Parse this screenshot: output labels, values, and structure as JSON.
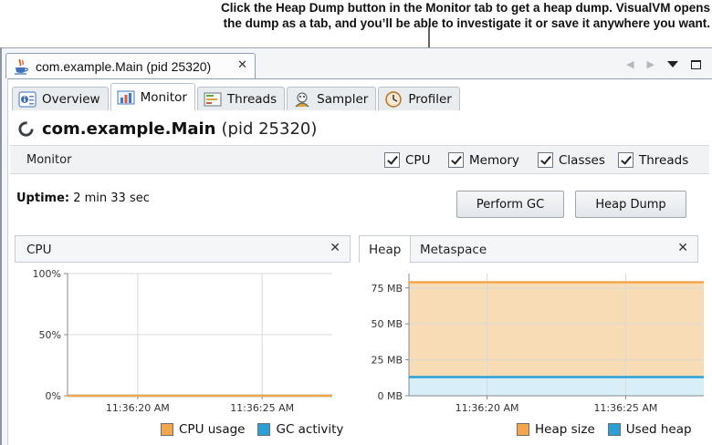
{
  "callout": {
    "line1": "Click the Heap Dump button in the Monitor tab to get a heap dump. VisualVM opens",
    "line2": "the dump as a tab, and you’ll be able to investigate it or save it anywhere you want."
  },
  "document_tab": {
    "label": "com.example.Main (pid 25320)",
    "close": "✕"
  },
  "subtabs": [
    {
      "label": "Overview",
      "icon": "overview-icon"
    },
    {
      "label": "Monitor",
      "icon": "monitor-chart-icon",
      "active": true
    },
    {
      "label": "Threads",
      "icon": "threads-icon"
    },
    {
      "label": "Sampler",
      "icon": "sampler-icon"
    },
    {
      "label": "Profiler",
      "icon": "profiler-icon"
    }
  ],
  "app": {
    "name": "com.example.Main",
    "pid": "(pid 25320)"
  },
  "monitor_bar": {
    "label": "Monitor",
    "checkboxes": [
      "CPU",
      "Memory",
      "Classes",
      "Threads"
    ]
  },
  "uptime": {
    "label": "Uptime:",
    "value": " 2 min 33 sec"
  },
  "buttons": {
    "perform_gc": "Perform GC",
    "heap_dump": "Heap Dump"
  },
  "cpu_panel": {
    "title": "CPU",
    "close": "✕",
    "legend": [
      "CPU usage",
      "GC activity"
    ]
  },
  "heap_panel": {
    "tabs": [
      "Heap",
      "Metaspace"
    ],
    "close": "✕",
    "legend": [
      "Heap size",
      "Used heap"
    ]
  },
  "colors": {
    "orange": "#f3a64b",
    "blue": "#2aa0d6",
    "heap_fill": "#f8dcb6",
    "used_fill": "#d8eef9"
  },
  "chart_data": [
    {
      "type": "line",
      "title": "CPU",
      "yticks": [
        "100%",
        "50%",
        "0%"
      ],
      "xticks": [
        "11:36:20 AM",
        "11:36:25 AM"
      ],
      "ylim": [
        0,
        100
      ],
      "series": [
        {
          "name": "CPU usage",
          "color": "#f3a64b",
          "values": [
            0,
            0
          ]
        },
        {
          "name": "GC activity",
          "color": "#2aa0d6",
          "values": [
            0,
            0
          ]
        }
      ]
    },
    {
      "type": "area",
      "title": "Heap",
      "yticks": [
        "75 MB",
        "50 MB",
        "25 MB",
        "0 MB"
      ],
      "xticks": [
        "11:36:20 AM",
        "11:36:25 AM"
      ],
      "ylim": [
        0,
        85
      ],
      "series": [
        {
          "name": "Heap size",
          "color": "#f3a64b",
          "values": [
            79,
            79
          ]
        },
        {
          "name": "Used heap",
          "color": "#2aa0d6",
          "values": [
            13,
            13
          ]
        }
      ]
    }
  ]
}
